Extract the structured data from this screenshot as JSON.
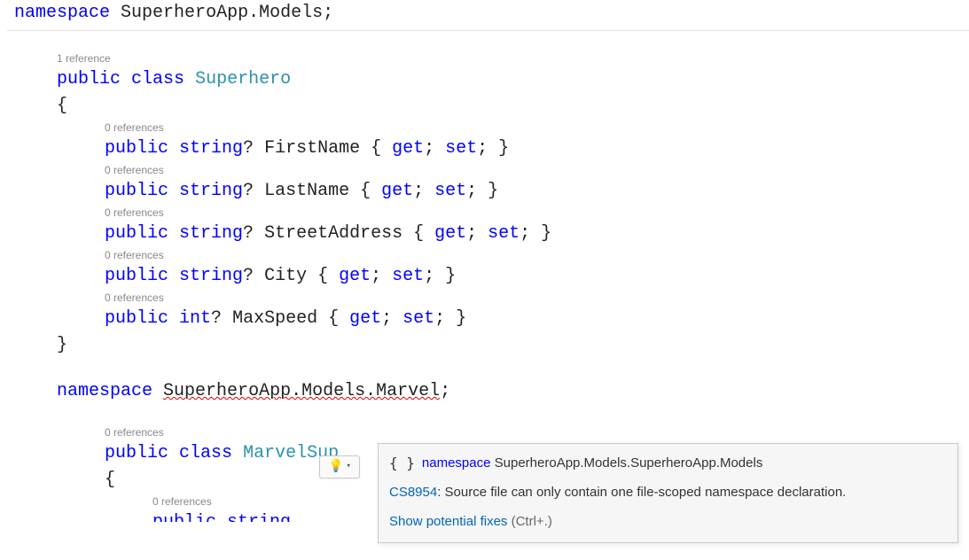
{
  "kw": {
    "namespace": "namespace",
    "public": "public",
    "class": "class",
    "string": "string",
    "int": "int",
    "get": "get",
    "set": "set"
  },
  "ns1": "SuperheroApp.Models",
  "class1": {
    "refs": "1 reference",
    "name": "Superhero",
    "props": {
      "p0": {
        "refs": "0 references",
        "name": "FirstName"
      },
      "p1": {
        "refs": "0 references",
        "name": "LastName"
      },
      "p2": {
        "refs": "0 references",
        "name": "StreetAddress"
      },
      "p3": {
        "refs": "0 references",
        "name": "City"
      },
      "p4": {
        "refs": "0 references",
        "name": "MaxSpeed"
      }
    }
  },
  "ns2": "SuperheroApp.Models.Marvel",
  "class2": {
    "refs": "0 references",
    "name_visible": "MarvelSup",
    "prop0": {
      "refs": "0 references",
      "line_visible": "public string[] MoviesIn { get; set; }"
    }
  },
  "punct": {
    "semi": ";",
    "lbrace": "{",
    "rbrace": "}",
    "q_accessors": "? ",
    "acc_open": " { ",
    "acc_mid": "; ",
    "acc_close": "; }"
  },
  "lightbulb": {
    "bulb_glyph": "💡",
    "chev_glyph": "▾"
  },
  "tooltip": {
    "braces": "{ }",
    "ns_kw": "namespace",
    "ns_full": "SuperheroApp.Models.SuperheroApp.Models",
    "error_code": "CS8954",
    "error_msg": ": Source file can only contain one file-scoped namespace declaration.",
    "fixes_link": "Show potential fixes",
    "fixes_shortcut": " (Ctrl+.)"
  }
}
